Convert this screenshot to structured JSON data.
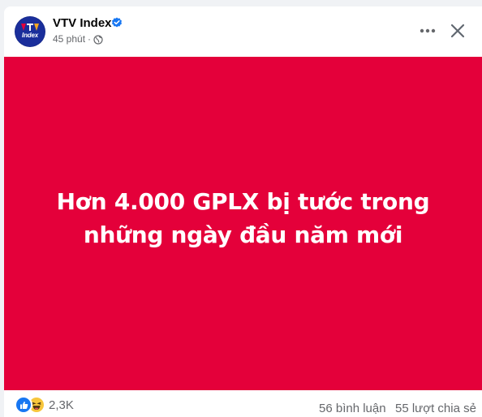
{
  "post": {
    "page_name": "VTV Index",
    "avatar_text": "Index",
    "time": "45 phút",
    "separator": "·",
    "image_text": "Hơn 4.000 GPLX bị tước trong những ngày đầu năm mới"
  },
  "footer": {
    "reaction_count": "2,3K",
    "comments": "56 bình luận",
    "shares": "55 lượt chia sẻ"
  },
  "colors": {
    "media_background": "#e4003a",
    "verified_blue": "#1877f2",
    "avatar_blue": "#1a2e9b"
  },
  "icons": {
    "verified": "verified-badge-icon",
    "audience": "globe-icon",
    "more": "more-options-icon",
    "close": "close-icon",
    "like": "like-icon",
    "haha": "haha-icon"
  }
}
